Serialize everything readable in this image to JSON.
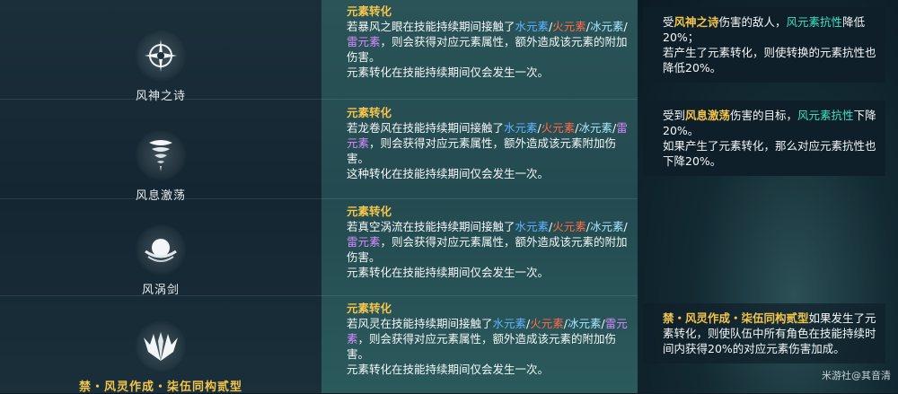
{
  "skills": [
    {
      "name": "风神之诗",
      "icon": "compass-star-icon"
    },
    {
      "name": "风息激荡",
      "icon": "tornado-icon"
    },
    {
      "name": "风涡剑",
      "icon": "vortex-orb-icon"
    },
    {
      "name": "禁・风灵作成・柒伍同构贰型",
      "icon": "wind-wings-icon"
    }
  ],
  "conversion": {
    "title": "元素转化",
    "row1": {
      "p1": "若暴风之眼在技能持续期间接触了",
      "water": "水元素",
      "sep": "/",
      "fire": "火元素",
      "ice": "冰元素",
      "elec": "雷元素",
      "p2": "，则会获得对应元素属性，额外造成该元素的附加伤害。",
      "p3": "元素转化在技能持续期间仅会发生一次。"
    },
    "row2": {
      "p1": "若龙卷风在技能持续期间接触了",
      "water": "水元素",
      "sep": "/",
      "fire": "火元素",
      "ice": "冰元素",
      "elec": "雷元素",
      "p2": "，则会获得对应元素属性，额外造成该元素附加伤害。",
      "p3": "这种转化在技能持续期间仅会发生一次。"
    },
    "row3": {
      "p1": "若真空涡流在技能持续期间接触了",
      "water": "水元素",
      "sep": "/",
      "fire": "火元素",
      "ice": "冰元素",
      "elec": "雷元素",
      "p2": "，则会获得对应元素属性，额外造成该元素的附加伤害。",
      "p3": "元素转化在技能持续期间仅会发生一次。"
    },
    "row4": {
      "p1": "若风灵在技能持续期间接触了",
      "water": "水元素",
      "sep": "/",
      "fire": "火元素",
      "ice": "冰元素",
      "elec": "雷元素",
      "p2": "，则会获得对应元素属性，额外造成该元素的附加伤害。",
      "p3": "元素转化在技能持续期间仅会发生一次。"
    }
  },
  "notes": {
    "n1": {
      "a": "受",
      "b": "风神之诗",
      "c": "伤害的敌人，",
      "d": "风元素抗性",
      "e": "降低20%；",
      "f": "若产生了元素转化，则使转换的元素抗性也降低20%。"
    },
    "n2": {
      "a": "受到",
      "b": "风息激荡",
      "c": "伤害的目标，",
      "d": "风元素抗性",
      "e": "下降20%。",
      "f": "如果产生了元素转化，那么对应元素抗性也下降20%。"
    },
    "n4": {
      "b": "禁・风灵作成・柒伍同构贰型",
      "c": "如果发生了元素转化，则使队伍中所有角色在技能持续时间内获得20%的对应元素伤害加成。"
    }
  },
  "watermark": "米游社@其音清"
}
